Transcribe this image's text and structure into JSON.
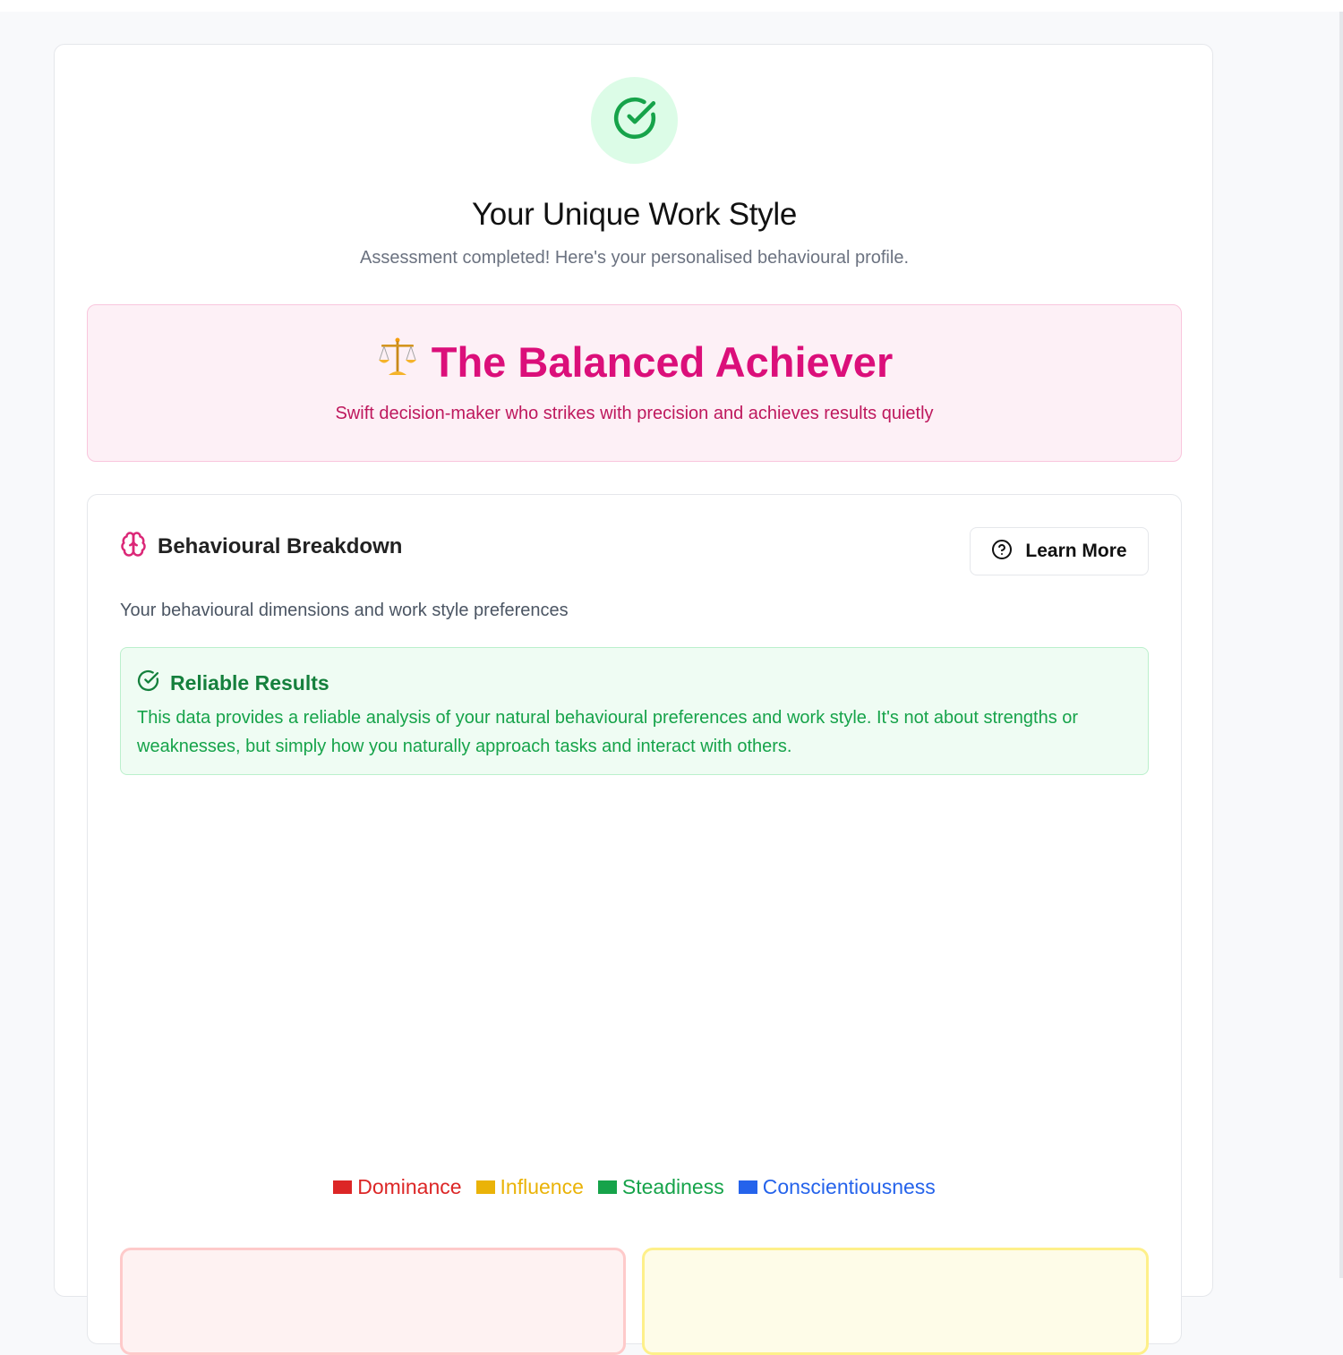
{
  "header": {
    "title": "Your Unique Work Style",
    "subtitle": "Assessment completed! Here's your personalised behavioural profile."
  },
  "profile": {
    "emoji": "⚖️",
    "name": "The Balanced Achiever",
    "tagline": "Swift decision-maker who strikes with precision and achieves results quietly"
  },
  "breakdown": {
    "title": "Behavioural Breakdown",
    "learn_more_label": "Learn More",
    "description": "Your behavioural dimensions and work style preferences",
    "reliable": {
      "title": "Reliable Results",
      "text": "This data provides a reliable analysis of your natural behavioural preferences and work style. It's not about strengths or weaknesses, but simply how you naturally approach tasks and interact with others."
    },
    "legend": [
      {
        "label": "Dominance",
        "color": "#dc2626"
      },
      {
        "label": "Influence",
        "color": "#eab308"
      },
      {
        "label": "Steadiness",
        "color": "#16a34a"
      },
      {
        "label": "Conscientiousness",
        "color": "#2563eb"
      }
    ]
  },
  "colors": {
    "accent_pink": "#db0f7a",
    "success_green": "#16a34a"
  }
}
